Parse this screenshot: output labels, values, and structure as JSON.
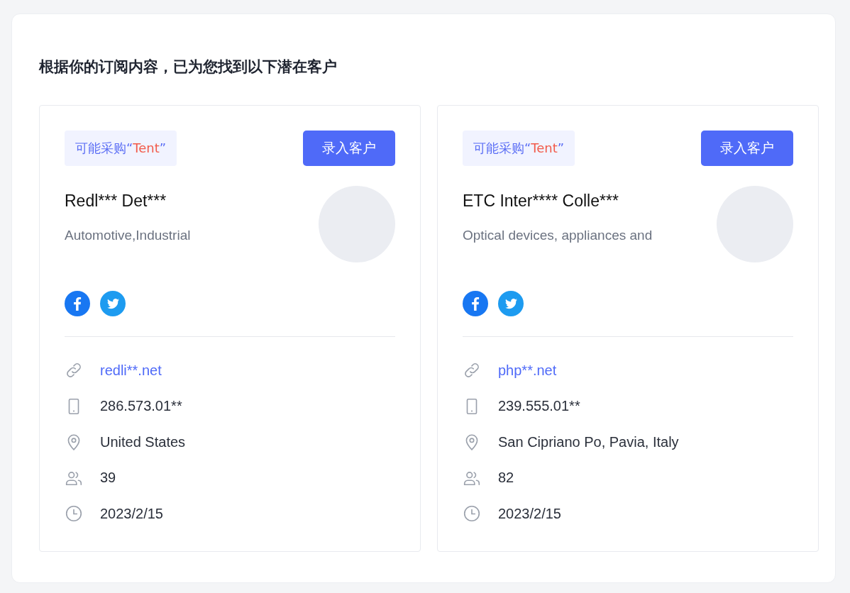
{
  "heading": "根据你的订阅内容，已为您找到以下潜在客户",
  "leads": [
    {
      "tag": {
        "prefix": "可能采购“",
        "keyword": "Tent",
        "suffix": "”"
      },
      "button": "录入客户",
      "name": "Redl*** Det***",
      "industry": "Automotive,Industrial",
      "details": [
        {
          "kind": "website",
          "text": "redli**.net"
        },
        {
          "kind": "phone",
          "text": "286.573.01**"
        },
        {
          "kind": "location",
          "text": "United States"
        },
        {
          "kind": "employees",
          "text": "39"
        },
        {
          "kind": "date",
          "text": "2023/2/15"
        }
      ]
    },
    {
      "tag": {
        "prefix": "可能采购“",
        "keyword": "Tent",
        "suffix": "”"
      },
      "button": "录入客户",
      "name": "ETC Inter**** Colle***",
      "industry": "Optical devices, appliances and",
      "details": [
        {
          "kind": "website",
          "text": "php**.net"
        },
        {
          "kind": "phone",
          "text": "239.555.01**"
        },
        {
          "kind": "location",
          "text": "San Cipriano Po, Pavia, Italy"
        },
        {
          "kind": "employees",
          "text": "82"
        },
        {
          "kind": "date",
          "text": "2023/2/15"
        }
      ]
    }
  ]
}
